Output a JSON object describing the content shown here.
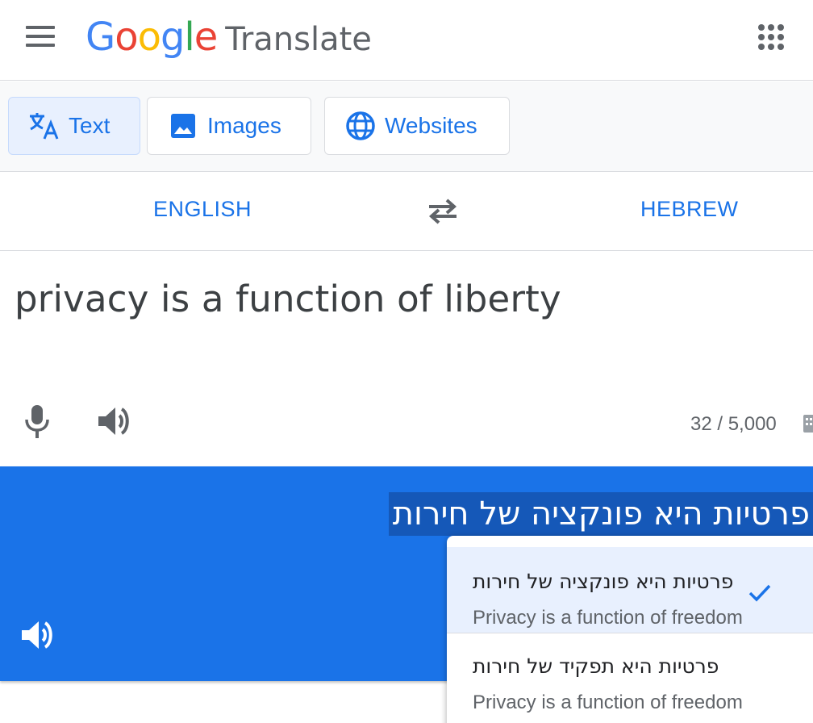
{
  "header": {
    "logo_letters": [
      {
        "ch": "G",
        "color": "#4285f4"
      },
      {
        "ch": "o",
        "color": "#ea4335"
      },
      {
        "ch": "o",
        "color": "#fbbc05"
      },
      {
        "ch": "g",
        "color": "#4285f4"
      },
      {
        "ch": "l",
        "color": "#34a853"
      },
      {
        "ch": "e",
        "color": "#ea4335"
      }
    ],
    "logo_word": "Google",
    "product_name": "Translate",
    "menu_icon": "hamburger-menu-icon",
    "apps_icon": "apps-grid-icon"
  },
  "modes": [
    {
      "label": "Text",
      "icon": "translate-icon",
      "active": true
    },
    {
      "label": "Images",
      "icon": "image-icon",
      "active": false
    },
    {
      "label": "Websites",
      "icon": "globe-icon",
      "active": false
    }
  ],
  "languages": {
    "source": "ENGLISH",
    "target": "HEBREW",
    "swap_icon": "swap-arrows-icon"
  },
  "source": {
    "text": "privacy is a function of liberty",
    "char_count": "32 / 5,000"
  },
  "target": {
    "text": "פרטיות היא פונקציה של חירות"
  },
  "alternatives": [
    {
      "translation": "פרטיות היא פונקציה של חירות",
      "back_translation": "Privacy is a function of freedom",
      "selected": true
    },
    {
      "translation": "פרטיות היא תפקיד של חירות",
      "back_translation": "Privacy is a function of freedom",
      "selected": false
    }
  ],
  "colors": {
    "accent": "#1a73e8",
    "highlight": "#1558b8",
    "selected_bg": "#e8f0fe"
  }
}
